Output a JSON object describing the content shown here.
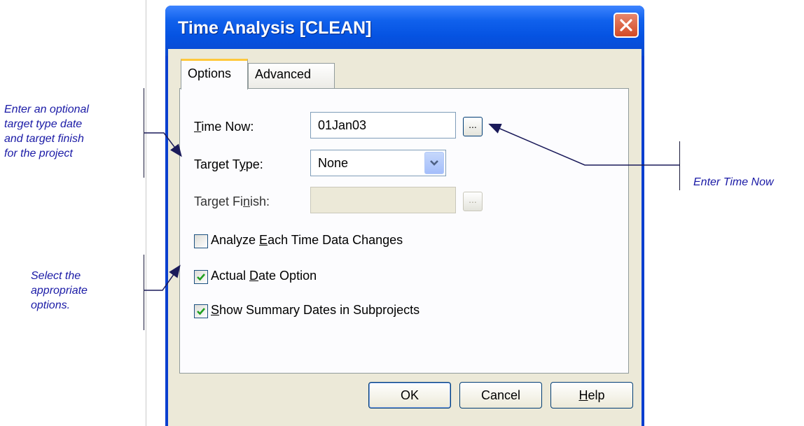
{
  "annotations": {
    "target_note": [
      "Enter an optional",
      "target type date",
      "and target finish",
      "for the project"
    ],
    "options_note": [
      "Select the",
      "appropriate",
      "options."
    ],
    "time_now_note": "Enter Time Now"
  },
  "dialog": {
    "title": "Time Analysis [CLEAN]",
    "tabs": [
      {
        "label": "Options",
        "active": true
      },
      {
        "label": "Advanced",
        "active": false
      }
    ],
    "time_now": {
      "label_pre": "",
      "label_u": "T",
      "label_post": "ime Now:",
      "value": "01Jan03",
      "button": "..."
    },
    "target_type": {
      "label_pre": "Target T",
      "label_u": "y",
      "label_post": "pe:",
      "value": "None"
    },
    "target_finish": {
      "label_pre": "Target Fi",
      "label_u": "n",
      "label_post": "ish:",
      "value": "",
      "button": "..."
    },
    "checkboxes": [
      {
        "pre": "Analyze ",
        "u": "E",
        "post": "ach Time Data Changes",
        "checked": false
      },
      {
        "pre": "Actual ",
        "u": "D",
        "post": "ate Option",
        "checked": true
      },
      {
        "pre": "",
        "u": "S",
        "post": "how Summary Dates in Subprojects",
        "checked": true
      }
    ],
    "buttons": {
      "ok": "OK",
      "cancel": "Cancel",
      "help_u": "H",
      "help_post": "elp"
    }
  },
  "colors": {
    "annotation": "#1a1aa6",
    "titlebar": "#0553e2",
    "check": "#21a121"
  },
  "icons": {
    "close": "close-icon",
    "dropdown": "chevron-down-icon",
    "check": "checkmark-icon"
  }
}
